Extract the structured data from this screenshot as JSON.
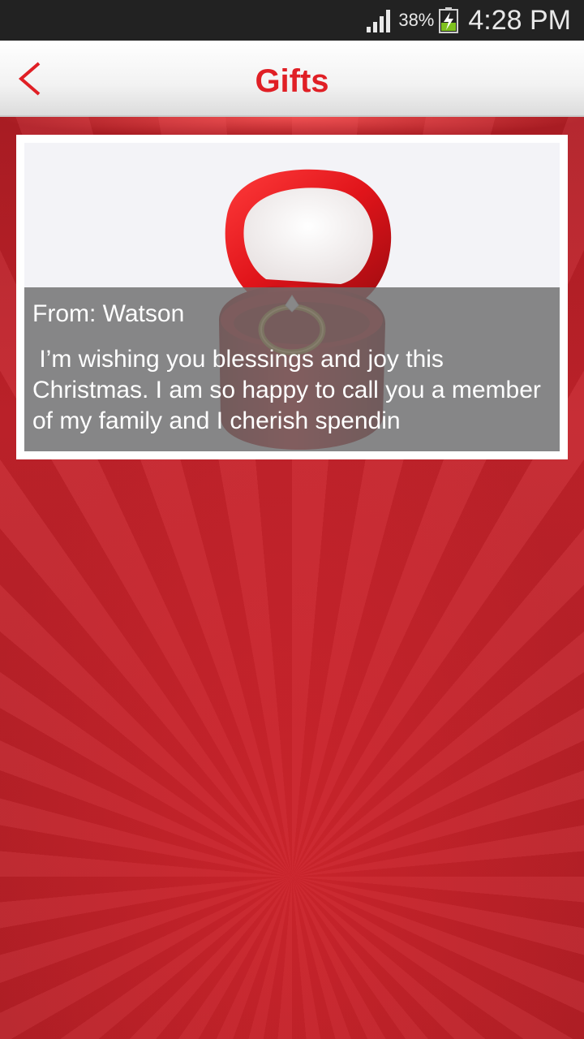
{
  "status_bar": {
    "battery_percent": "38%",
    "time": "4:28 PM",
    "signal_icon": "signal-bars-icon",
    "battery_icon": "battery-charging-icon"
  },
  "header": {
    "title": "Gifts",
    "back_icon": "chevron-left-icon"
  },
  "gift": {
    "image": "red-ring-box-image",
    "from": "From: Watson",
    "message": " I’m wishing you blessings and joy this Christmas. I am so happy to call you a member of my family and I cherish spendin"
  },
  "colors": {
    "accent": "#e01f25",
    "background": "#b51f26",
    "status_bar": "#222222"
  }
}
